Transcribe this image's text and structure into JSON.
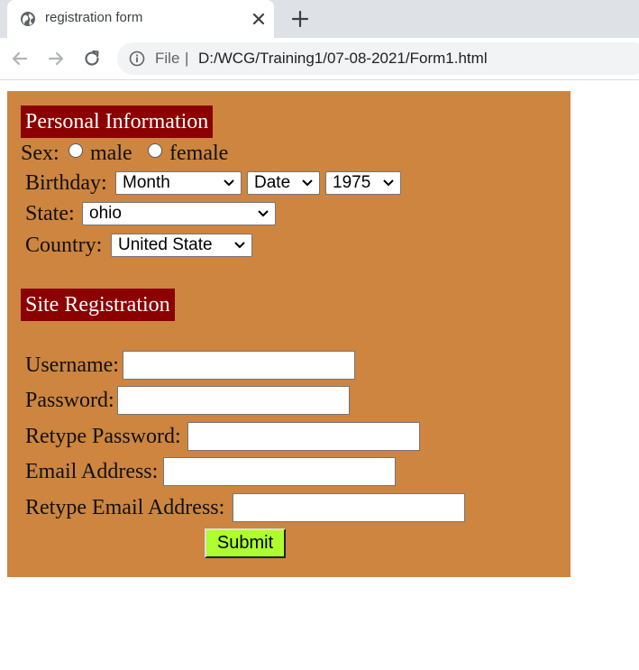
{
  "browser": {
    "tab_title": "registration form",
    "file_label": "File",
    "separator": "|",
    "url": "D:/WCG/Training1/07-08-2021/Form1.html"
  },
  "personal": {
    "heading": "Personal Information",
    "sex_label": "Sex:",
    "male_label": "male",
    "female_label": "female",
    "birthday_label": "Birthday:",
    "month_value": "Month",
    "date_value": "Date",
    "year_value": "1975",
    "state_label": "State:",
    "state_value": "ohio",
    "country_label": "Country:",
    "country_value": "United State"
  },
  "site": {
    "heading": "Site Registration",
    "username_label": "Username:",
    "password_label": "Password:",
    "retype_password_label": "Retype Password:",
    "email_label": "Email Address:",
    "retype_email_label": "Retype Email Address:",
    "submit_label": "Submit"
  },
  "colors": {
    "panel_background": "#cd853f",
    "heading_background": "#8b0000",
    "submit_background": "#adff2f"
  }
}
